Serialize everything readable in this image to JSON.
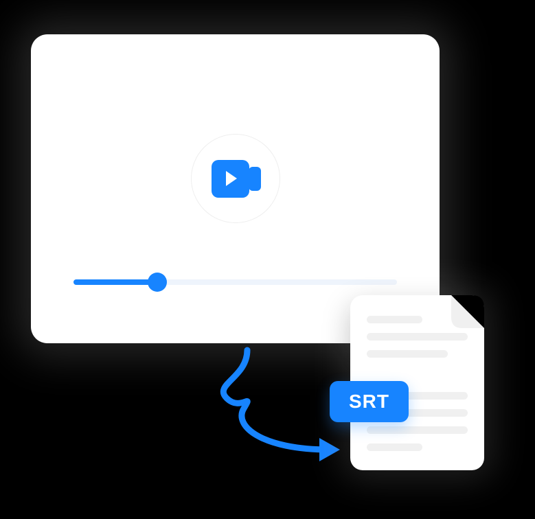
{
  "colors": {
    "accent": "#1784ff",
    "card_bg": "#ffffff",
    "page_bg": "#000000",
    "track": "#eef4fc",
    "file_line": "#f0f0f0"
  },
  "video": {
    "progress_percent": 26
  },
  "file": {
    "badge_label": "SRT"
  }
}
